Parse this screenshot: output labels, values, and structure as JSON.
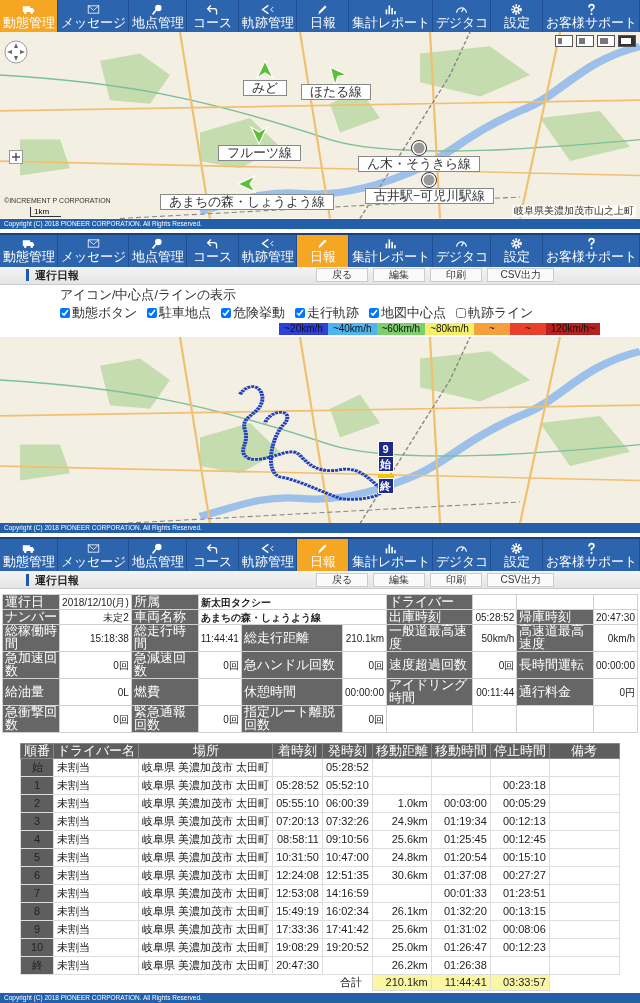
{
  "live_view": {
    "nav": [
      {
        "label": "動態管理",
        "selected": true
      },
      {
        "label": "メッセージ",
        "selected": false
      },
      {
        "label": "地点管理",
        "selected": false
      },
      {
        "label": "コース",
        "selected": false
      },
      {
        "label": "軌跡管理",
        "selected": false
      },
      {
        "label": "日報",
        "selected": false
      },
      {
        "label": "集計レポート",
        "selected": false
      },
      {
        "label": "デジタコ",
        "selected": false
      },
      {
        "label": "設定",
        "selected": false
      },
      {
        "label": "お客様サポート",
        "selected": false
      }
    ],
    "map": {
      "vehicles": [
        {
          "kind": "arrow",
          "label": "みど"
        },
        {
          "kind": "arrow",
          "label": "ほたる線"
        },
        {
          "kind": "arrow",
          "label": "フルーツ線"
        },
        {
          "kind": "arrow",
          "label": "あまちの森・しょうよう線"
        },
        {
          "kind": "parked",
          "label": "ん木・そうきら線"
        },
        {
          "kind": "parked",
          "label": "古井駅−可児川駅線"
        }
      ],
      "scale": "1km",
      "credit": "©INCREMENT P CORPORATION",
      "address": "岐阜県美濃加茂市山之上町"
    },
    "footer": "Copyright (C) 2018 PIONEER CORPORATION. All Rights Reserved."
  },
  "route_view": {
    "nav": [
      {
        "label": "動態管理",
        "selected": false
      },
      {
        "label": "メッセージ",
        "selected": false
      },
      {
        "label": "地点管理",
        "selected": false
      },
      {
        "label": "コース",
        "selected": false
      },
      {
        "label": "軌跡管理",
        "selected": false
      },
      {
        "label": "日報",
        "selected": true
      },
      {
        "label": "集計レポート",
        "selected": false
      },
      {
        "label": "デジタコ",
        "selected": false
      },
      {
        "label": "設定",
        "selected": false
      },
      {
        "label": "お客様サポート",
        "selected": false
      }
    ],
    "title": "運行日報",
    "buttons": [
      "戻る",
      "編集",
      "印刷",
      "CSV出力"
    ],
    "options_label": "アイコン/中心点/ラインの表示",
    "options": [
      {
        "label": "動態ボタン",
        "checked": true
      },
      {
        "label": "駐車地点",
        "checked": true
      },
      {
        "label": "危険挙動",
        "checked": true
      },
      {
        "label": "走行軌跡",
        "checked": true
      },
      {
        "label": "地図中心点",
        "checked": true
      },
      {
        "label": "軌跡ライン",
        "checked": false
      }
    ],
    "speed_legend": [
      {
        "label": "~20km/h",
        "color": "#2f3fd8"
      },
      {
        "label": "~40km/h",
        "color": "#4fb3f0"
      },
      {
        "label": "~60km/h",
        "color": "#7ccf6a"
      },
      {
        "label": "~80km/h",
        "color": "#f4ee6a"
      },
      {
        "label": "~",
        "color": "#f5a03c"
      },
      {
        "label": "~",
        "color": "#e8402a"
      },
      {
        "label": "120km/h~",
        "color": "#b82020"
      }
    ],
    "map": {
      "markers": [
        {
          "kind": "stop",
          "label": "9"
        },
        {
          "kind": "start",
          "label": "始"
        },
        {
          "kind": "end",
          "label": "終"
        }
      ]
    },
    "footer": "Copyright (C) 2018 PIONEER CORPORATION. All Rights Reserved."
  },
  "report_view": {
    "nav": [
      {
        "label": "動態管理",
        "selected": false
      },
      {
        "label": "メッセージ",
        "selected": false
      },
      {
        "label": "地点管理",
        "selected": false
      },
      {
        "label": "コース",
        "selected": false
      },
      {
        "label": "軌跡管理",
        "selected": false
      },
      {
        "label": "日報",
        "selected": true
      },
      {
        "label": "集計レポート",
        "selected": false
      },
      {
        "label": "デジタコ",
        "selected": false
      },
      {
        "label": "設定",
        "selected": false
      },
      {
        "label": "お客様サポート",
        "selected": false
      }
    ],
    "title": "運行日報",
    "buttons": [
      "戻る",
      "編集",
      "印刷",
      "CSV出力"
    ],
    "summary": [
      [
        {
          "kind": "label",
          "text": "運行日"
        },
        {
          "kind": "value",
          "text": "2018/12/10(月)"
        },
        {
          "kind": "label",
          "text": "所属"
        },
        {
          "kind": "wide_value",
          "text": "新太田タクシー"
        },
        {
          "kind": "label",
          "text": "ドライバー"
        },
        {
          "kind": "blank"
        },
        {
          "kind": "blank"
        },
        {
          "kind": "blank"
        }
      ],
      [
        {
          "kind": "label",
          "text": "ナンバー"
        },
        {
          "kind": "value",
          "text": "未定2"
        },
        {
          "kind": "label",
          "text": "車両名称"
        },
        {
          "kind": "wide_value",
          "text": "あまちの森・しょうよう線"
        },
        {
          "kind": "label",
          "text": "出庫時刻"
        },
        {
          "kind": "value",
          "text": "05:28:52"
        },
        {
          "kind": "label",
          "text": "帰庫時刻"
        },
        {
          "kind": "value",
          "text": "20:47:30"
        }
      ],
      [
        {
          "kind": "label",
          "text": "総稼働時間"
        },
        {
          "kind": "value",
          "text": "15:18:38"
        },
        {
          "kind": "label",
          "text": "総走行時間"
        },
        {
          "kind": "value",
          "text": "11:44:41"
        },
        {
          "kind": "label",
          "text": "総走行距離"
        },
        {
          "kind": "value",
          "text": "210.1km"
        },
        {
          "kind": "label",
          "text": "一般道最高速度"
        },
        {
          "kind": "value",
          "text": "50km/h"
        },
        {
          "kind": "label",
          "text": "高速道最高速度"
        },
        {
          "kind": "value",
          "text": "0km/h"
        }
      ],
      [
        {
          "kind": "label",
          "text": "急加速回数"
        },
        {
          "kind": "value",
          "text": "0回"
        },
        {
          "kind": "label",
          "text": "急減速回数"
        },
        {
          "kind": "value",
          "text": "0回"
        },
        {
          "kind": "label",
          "text": "急ハンドル回数"
        },
        {
          "kind": "value",
          "text": "0回"
        },
        {
          "kind": "label",
          "text": "速度超過回数"
        },
        {
          "kind": "value",
          "text": "0回"
        },
        {
          "kind": "label",
          "text": "長時間運転"
        },
        {
          "kind": "value",
          "text": "00:00:00"
        }
      ],
      [
        {
          "kind": "label",
          "text": "給油量"
        },
        {
          "kind": "value",
          "text": "0L"
        },
        {
          "kind": "label",
          "text": "燃費"
        },
        {
          "kind": "blank"
        },
        {
          "kind": "label",
          "text": "休憩時間"
        },
        {
          "kind": "value",
          "text": "00:00:00"
        },
        {
          "kind": "label",
          "text": "アイドリング時間"
        },
        {
          "kind": "value",
          "text": "00:11:44"
        },
        {
          "kind": "label",
          "text": "通行料金"
        },
        {
          "kind": "value",
          "text": "0円"
        }
      ],
      [
        {
          "kind": "label",
          "text": "急衝撃回数"
        },
        {
          "kind": "value",
          "text": "0回"
        },
        {
          "kind": "label",
          "text": "緊急通報回数"
        },
        {
          "kind": "value",
          "text": "0回"
        },
        {
          "kind": "label",
          "text": "指定ルート離脱回数"
        },
        {
          "kind": "value",
          "text": "0回"
        },
        {
          "kind": "blank"
        },
        {
          "kind": "blank"
        },
        {
          "kind": "blank"
        },
        {
          "kind": "blank"
        }
      ]
    ],
    "stops": {
      "columns": [
        "順番",
        "ドライバー名",
        "場所",
        "着時刻",
        "発時刻",
        "移動距離",
        "移動時間",
        "停止時間",
        "備考"
      ],
      "rows": [
        {
          "order": "始",
          "driver": "未割当",
          "place": "岐阜県 美濃加茂市 太田町",
          "depart": "05:28:52"
        },
        {
          "order": "1",
          "driver": "未割当",
          "place": "岐阜県 美濃加茂市 太田町",
          "arrive": "05:28:52",
          "depart": "05:52:10",
          "stopped": "00:23:18"
        },
        {
          "order": "2",
          "driver": "未割当",
          "place": "岐阜県 美濃加茂市 太田町",
          "arrive": "05:55:10",
          "depart": "06:00:39",
          "distance": "1.0km",
          "moving": "00:03:00",
          "stopped": "00:05:29"
        },
        {
          "order": "3",
          "driver": "未割当",
          "place": "岐阜県 美濃加茂市 太田町",
          "arrive": "07:20:13",
          "depart": "07:32:26",
          "distance": "24.9km",
          "moving": "01:19:34",
          "stopped": "00:12:13"
        },
        {
          "order": "4",
          "driver": "未割当",
          "place": "岐阜県 美濃加茂市 太田町",
          "arrive": "08:58:11",
          "depart": "09:10:56",
          "distance": "25.6km",
          "moving": "01:25:45",
          "stopped": "00:12:45"
        },
        {
          "order": "5",
          "driver": "未割当",
          "place": "岐阜県 美濃加茂市 太田町",
          "arrive": "10:31:50",
          "depart": "10:47:00",
          "distance": "24.8km",
          "moving": "01:20:54",
          "stopped": "00:15:10"
        },
        {
          "order": "6",
          "driver": "未割当",
          "place": "岐阜県 美濃加茂市 太田町",
          "arrive": "12:24:08",
          "depart": "12:51:35",
          "distance": "30.6km",
          "moving": "01:37:08",
          "stopped": "00:27:27"
        },
        {
          "order": "7",
          "driver": "未割当",
          "place": "岐阜県 美濃加茂市 太田町",
          "arrive": "12:53:08",
          "depart": "14:16:59",
          "moving": "00:01:33",
          "stopped": "01:23:51"
        },
        {
          "order": "8",
          "driver": "未割当",
          "place": "岐阜県 美濃加茂市 太田町",
          "arrive": "15:49:19",
          "depart": "16:02:34",
          "distance": "26.1km",
          "moving": "01:32:20",
          "stopped": "00:13:15"
        },
        {
          "order": "9",
          "driver": "未割当",
          "place": "岐阜県 美濃加茂市 太田町",
          "arrive": "17:33:36",
          "depart": "17:41:42",
          "distance": "25.6km",
          "moving": "01:31:02",
          "stopped": "00:08:06"
        },
        {
          "order": "10",
          "driver": "未割当",
          "place": "岐阜県 美濃加茂市 太田町",
          "arrive": "19:08:29",
          "depart": "19:20:52",
          "distance": "25.0km",
          "moving": "01:26:47",
          "stopped": "00:12:23"
        },
        {
          "order": "終",
          "driver": "未割当",
          "place": "岐阜県 美濃加茂市 太田町",
          "arrive": "20:47:30",
          "distance": "26.2km",
          "moving": "01:26:38"
        }
      ],
      "total": {
        "label": "合計",
        "distance": "210.1km",
        "moving": "11:44:41",
        "stopped": "03:33:57"
      }
    },
    "footer": "Copyright (C) 2018 PIONEER CORPORATION. All Rights Reserved."
  }
}
